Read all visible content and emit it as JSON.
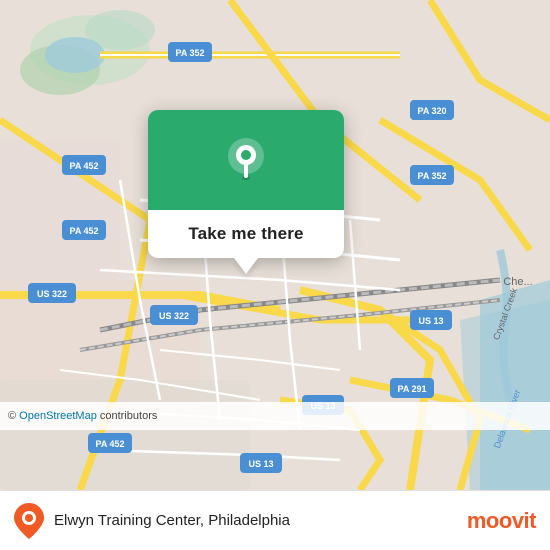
{
  "map": {
    "background_color": "#e8e0d8",
    "popup": {
      "button_label": "Take me there",
      "icon_bg_color": "#2baa6e"
    },
    "attribution": "© OpenStreetMap contributors",
    "roads": {
      "highway_color": "#f9d84a",
      "road_color": "#ffffff",
      "minor_road_color": "#e8e0d8"
    }
  },
  "footer": {
    "location_name": "Elwyn Training Center, Philadelphia",
    "moovit_label": "moovit"
  }
}
